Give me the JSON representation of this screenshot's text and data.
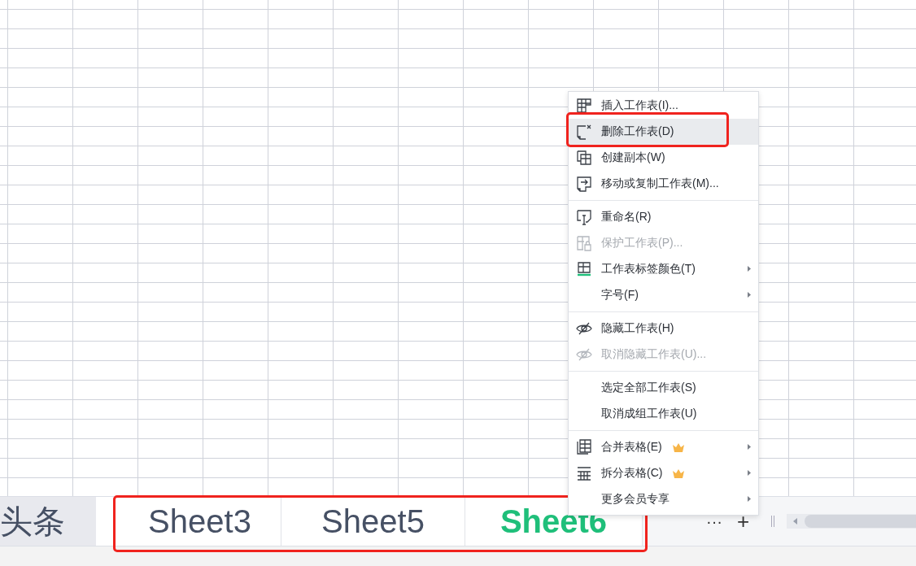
{
  "sheet_tabs": [
    {
      "label": "头条",
      "selected": false
    },
    {
      "label": "Sheet3",
      "selected": false
    },
    {
      "label": "Sheet5",
      "selected": false
    },
    {
      "label": "Sheet6",
      "selected": true
    }
  ],
  "tab_bar": {
    "more": "···",
    "add": "+"
  },
  "context_menu": {
    "groups": [
      [
        {
          "label": "插入工作表(I)...",
          "disabled": false,
          "selected": false,
          "submenu": false,
          "vip": false
        },
        {
          "label": "删除工作表(D)",
          "disabled": false,
          "selected": true,
          "submenu": false,
          "vip": false
        },
        {
          "label": "创建副本(W)",
          "disabled": false,
          "selected": false,
          "submenu": false,
          "vip": false
        },
        {
          "label": "移动或复制工作表(M)...",
          "disabled": false,
          "selected": false,
          "submenu": false,
          "vip": false
        }
      ],
      [
        {
          "label": "重命名(R)",
          "disabled": false,
          "selected": false,
          "submenu": false,
          "vip": false
        },
        {
          "label": "保护工作表(P)...",
          "disabled": true,
          "selected": false,
          "submenu": false,
          "vip": false
        },
        {
          "label": "工作表标签颜色(T)",
          "disabled": false,
          "selected": false,
          "submenu": true,
          "vip": false
        },
        {
          "label": "字号(F)",
          "disabled": false,
          "selected": false,
          "submenu": true,
          "vip": false
        }
      ],
      [
        {
          "label": "隐藏工作表(H)",
          "disabled": false,
          "selected": false,
          "submenu": false,
          "vip": false
        },
        {
          "label": "取消隐藏工作表(U)...",
          "disabled": true,
          "selected": false,
          "submenu": false,
          "vip": false
        }
      ],
      [
        {
          "label": "选定全部工作表(S)",
          "disabled": false,
          "selected": false,
          "submenu": false,
          "vip": false
        },
        {
          "label": "取消成组工作表(U)",
          "disabled": false,
          "selected": false,
          "submenu": false,
          "vip": false
        }
      ],
      [
        {
          "label": "合并表格(E)",
          "disabled": false,
          "selected": false,
          "submenu": true,
          "vip": true
        },
        {
          "label": "拆分表格(C)",
          "disabled": false,
          "selected": false,
          "submenu": true,
          "vip": true
        },
        {
          "label": "更多会员专享",
          "disabled": false,
          "selected": false,
          "submenu": true,
          "vip": false
        }
      ]
    ]
  }
}
